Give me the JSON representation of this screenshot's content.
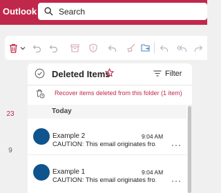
{
  "app": {
    "title": "Outlook"
  },
  "search": {
    "placeholder": "Search"
  },
  "ribbon": {
    "buttons": [
      "delete-icon",
      "chevron-down-icon",
      "undo-icon",
      "undo-icon",
      "archive-icon",
      "report-icon",
      "reply-icon",
      "sweep-icon",
      "move-to-folder-icon",
      "reply-icon",
      "reply-all-icon",
      "forward-icon"
    ]
  },
  "calendar_rail": {
    "days": [
      "23",
      "9"
    ]
  },
  "folder": {
    "title": "Deleted Items",
    "filter_label": "Filter",
    "recover_text": "Recover items deleted from this folder (1 item)"
  },
  "groups": [
    {
      "label": "Today"
    }
  ],
  "messages": [
    {
      "sender": "Example 2",
      "time": "9:04 AM",
      "preview": "CAUTION: This email originates fro..."
    },
    {
      "sender": "Example 1",
      "time": "9:04 AM",
      "preview": "CAUTION: This email originates fro..."
    }
  ],
  "colors": {
    "brand": "#c0284b",
    "avatar": "#0f548c",
    "accent": "#c0284b"
  }
}
